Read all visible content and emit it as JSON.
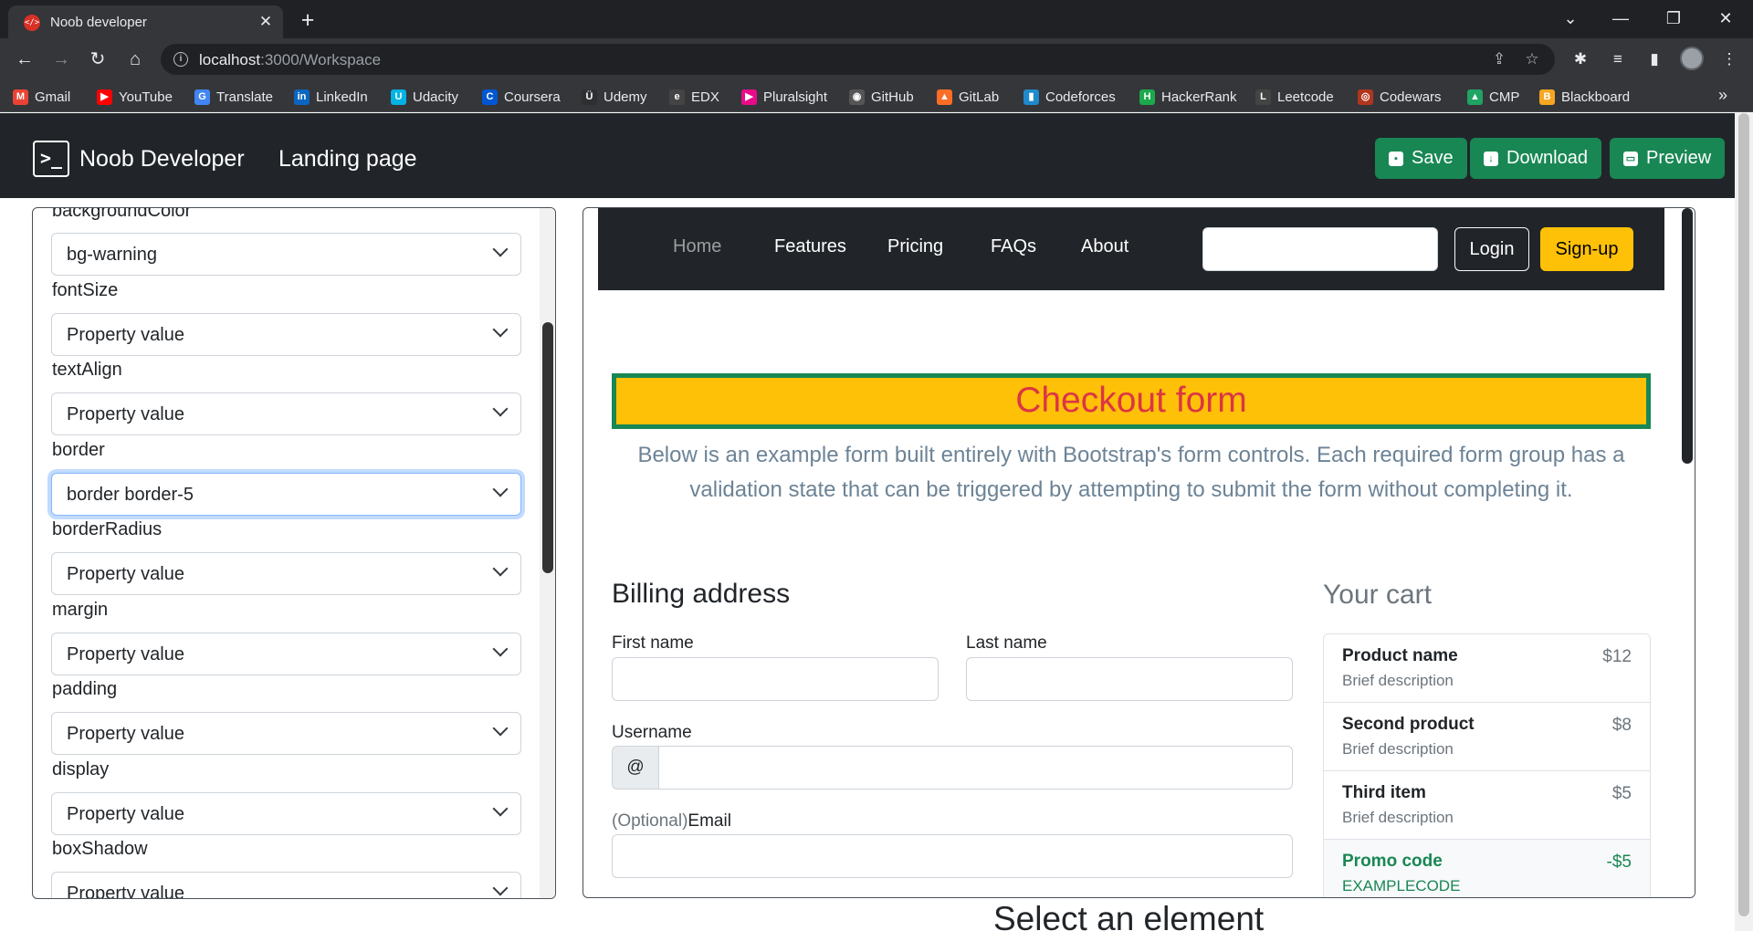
{
  "browser": {
    "tab_title": "Noob developer",
    "url_host": "localhost",
    "url_path": ":3000/Workspace",
    "bookmarks": [
      {
        "label": "Gmail",
        "icon": "gmail-icon",
        "color": "#ea4335"
      },
      {
        "label": "YouTube",
        "icon": "youtube-icon",
        "color": "#ff0000"
      },
      {
        "label": "Translate",
        "icon": "translate-icon",
        "color": "#4285f4"
      },
      {
        "label": "LinkedIn",
        "icon": "linkedin-icon",
        "color": "#0a66c2"
      },
      {
        "label": "Udacity",
        "icon": "udacity-icon",
        "color": "#02b3e4"
      },
      {
        "label": "Coursera",
        "icon": "coursera-icon",
        "color": "#0056d2"
      },
      {
        "label": "Udemy",
        "icon": "udemy-icon",
        "color": "#2d2f31"
      },
      {
        "label": "EDX",
        "icon": "edx-icon",
        "color": "#444"
      },
      {
        "label": "Pluralsight",
        "icon": "pluralsight-icon",
        "color": "#e80a89"
      },
      {
        "label": "GitHub",
        "icon": "github-icon",
        "color": "#555"
      },
      {
        "label": "GitLab",
        "icon": "gitlab-icon",
        "color": "#fc6d26"
      },
      {
        "label": "Codeforces",
        "icon": "codeforces-icon",
        "color": "#1f8acb"
      },
      {
        "label": "HackerRank",
        "icon": "hackerrank-icon",
        "color": "#1ba94c"
      },
      {
        "label": "Leetcode",
        "icon": "leetcode-icon",
        "color": "#444"
      },
      {
        "label": "Codewars",
        "icon": "codewars-icon",
        "color": "#b1361e"
      },
      {
        "label": "CMP",
        "icon": "google-drive-icon",
        "color": "#1fa463"
      },
      {
        "label": "Blackboard",
        "icon": "blackboard-icon",
        "color": "#f5a623"
      }
    ]
  },
  "app": {
    "brand": "Noob Developer",
    "page": "Landing page",
    "save_label": "Save",
    "download_label": "Download",
    "preview_label": "Preview"
  },
  "properties": {
    "top_label": "backgroundColor",
    "items": [
      {
        "value": "bg-warning"
      },
      {
        "label": "fontSize",
        "value": "Property value"
      },
      {
        "label": "textAlign",
        "value": "Property value"
      },
      {
        "label": "border",
        "value": "border border-5"
      },
      {
        "label": "borderRadius",
        "value": "Property value"
      },
      {
        "label": "margin",
        "value": "Property value"
      },
      {
        "label": "padding",
        "value": "Property value"
      },
      {
        "label": "display",
        "value": "Property value"
      },
      {
        "label": "boxShadow",
        "value": "Property value"
      }
    ]
  },
  "preview": {
    "nav": [
      "Home",
      "Features",
      "Pricing",
      "FAQs",
      "About"
    ],
    "login": "Login",
    "signup": "Sign-up",
    "title": "Checkout form",
    "lead": "Below is an example form built entirely with Bootstrap's form controls. Each required form group has a validation state that can be triggered by attempting to submit the form without completing it.",
    "billing_heading": "Billing address",
    "first_name": "First name",
    "last_name": "Last name",
    "username": "Username",
    "at": "@",
    "email_optional": "(Optional)",
    "email": "Email",
    "cart_heading": "Your cart",
    "cart": [
      {
        "name": "Product name",
        "desc": "Brief description",
        "price": "$12"
      },
      {
        "name": "Second product",
        "desc": "Brief description",
        "price": "$8"
      },
      {
        "name": "Third item",
        "desc": "Brief description",
        "price": "$5"
      },
      {
        "name": "Promo code",
        "desc": "EXAMPLECODE",
        "price": "-$5"
      }
    ]
  },
  "footer_heading": "Select an element"
}
